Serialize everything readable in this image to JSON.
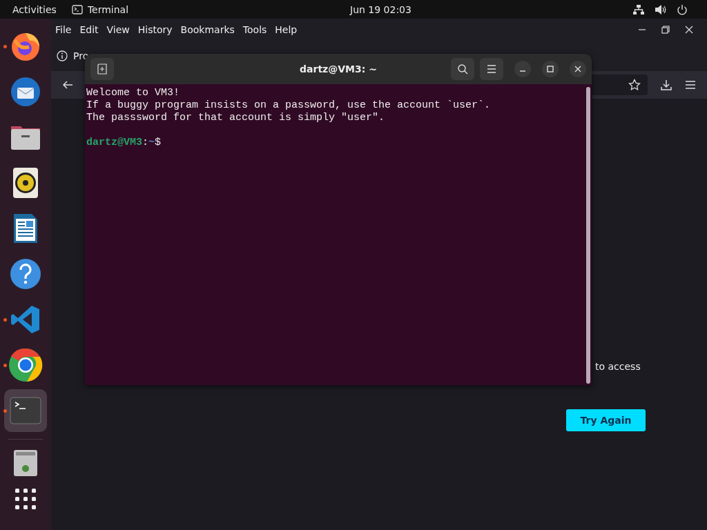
{
  "top_bar": {
    "activities": "Activities",
    "app_name": "Terminal",
    "clock": "Jun 19  02:03"
  },
  "dock": {
    "items": [
      {
        "kind": "firefox",
        "running": true,
        "selected": false
      },
      {
        "kind": "thunderbird",
        "running": false,
        "selected": false
      },
      {
        "kind": "files",
        "running": false,
        "selected": false
      },
      {
        "kind": "rhythmbox",
        "running": false,
        "selected": false
      },
      {
        "kind": "writer",
        "running": false,
        "selected": false
      },
      {
        "kind": "help",
        "running": false,
        "selected": false
      },
      {
        "kind": "vscode",
        "running": true,
        "selected": false
      },
      {
        "kind": "chrome",
        "running": true,
        "selected": false
      },
      {
        "kind": "terminal",
        "running": true,
        "selected": true
      }
    ]
  },
  "browser": {
    "menu": [
      "File",
      "Edit",
      "View",
      "History",
      "Bookmarks",
      "Tools",
      "Help"
    ],
    "tab": {
      "title": "Pro"
    },
    "content": {
      "text": "to access",
      "button": "Try Again"
    }
  },
  "terminal": {
    "title": "dartz@VM3: ~",
    "lines": [
      "Welcome to VM3!",
      "If a buggy program insists on a password, use the account `user`.",
      "The passsword for that account is simply \"user\"."
    ],
    "prompt": {
      "user_host": "dartz@VM3",
      "separator": ":",
      "path": "~",
      "symbol": "$"
    }
  }
}
